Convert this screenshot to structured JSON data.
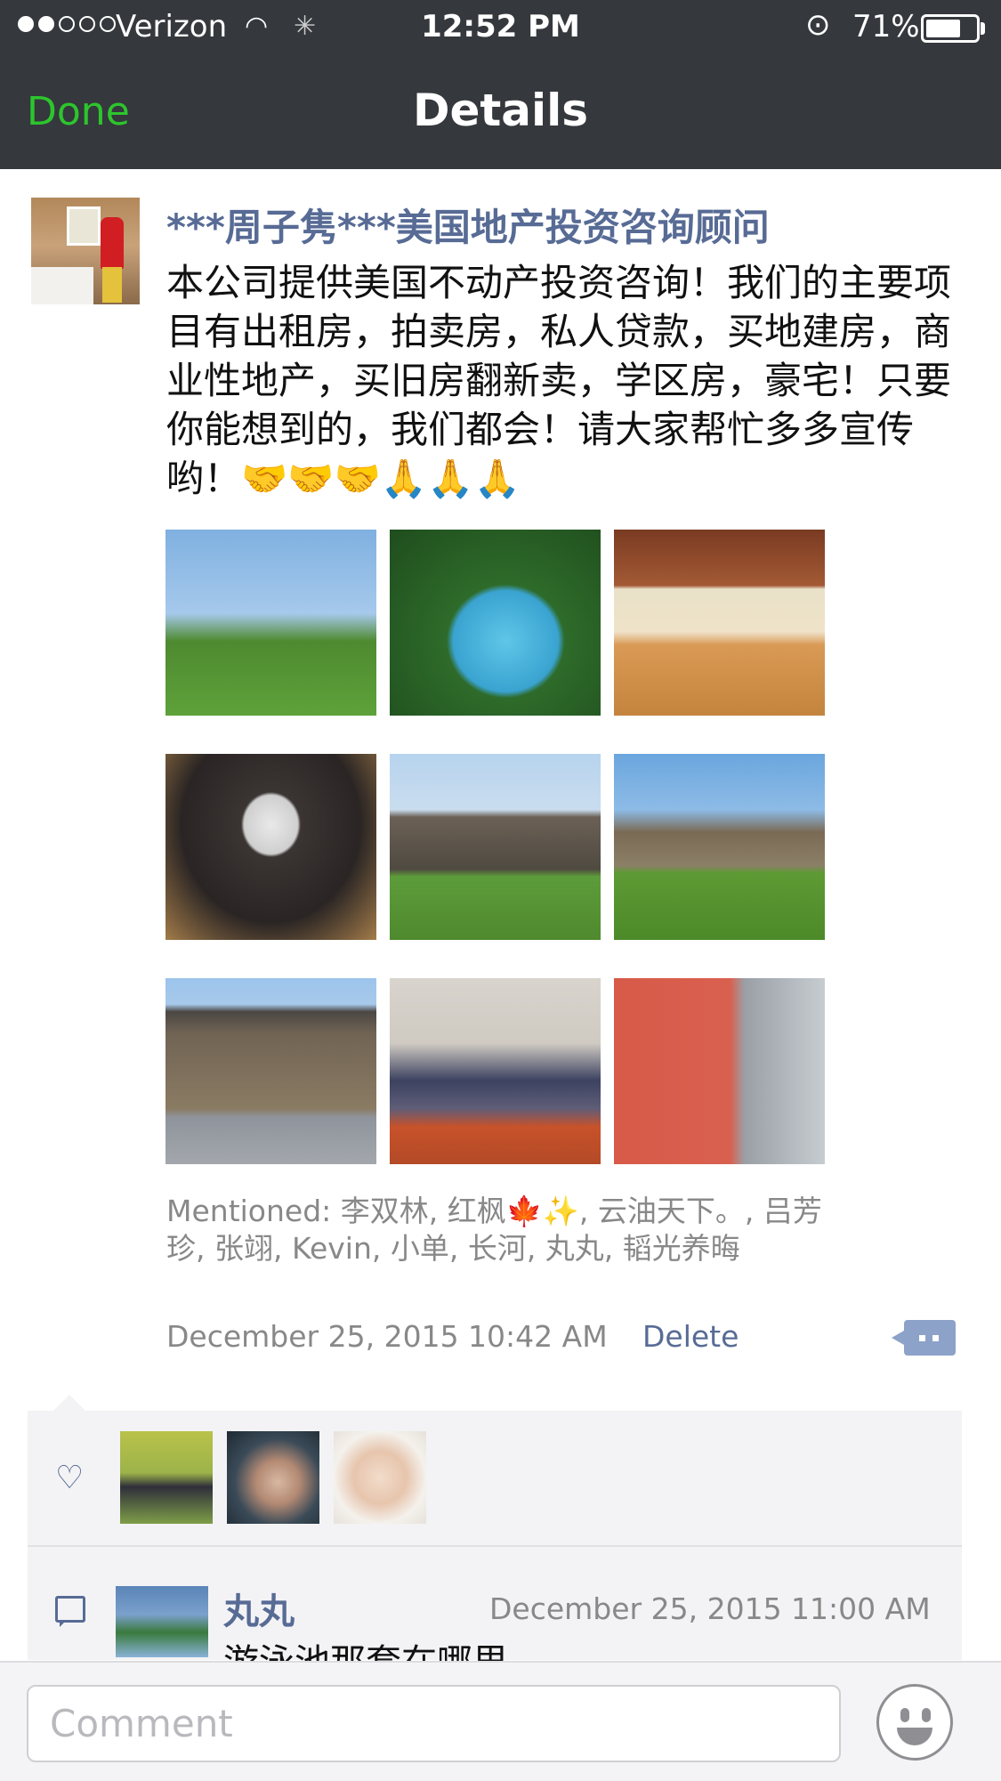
{
  "status_bar": {
    "carrier": "Verizon",
    "time": "12:52 PM",
    "battery_percent": "71%",
    "battery_level": 0.71,
    "signal_bars_filled": 2,
    "signal_bars_total": 5
  },
  "nav": {
    "done_label": "Done",
    "title": "Details"
  },
  "post": {
    "author": "***周子隽***美国地产投资咨询顾问",
    "text": "本公司提供美国不动产投资咨询！我们的主要项目有出租房，拍卖房，私人贷款，买地建房，商业性地产，买旧房翻新卖，学区房，豪宅！只要你能想到的，我们都会！请大家帮忙多多宣传哟！🤝🤝🤝🙏🙏🙏",
    "photos": [
      {
        "name": "house-lawn-photo"
      },
      {
        "name": "pool-photo"
      },
      {
        "name": "basketball-court-photo"
      },
      {
        "name": "home-theater-photo"
      },
      {
        "name": "greenhouse-photo"
      },
      {
        "name": "house-garden-photo"
      },
      {
        "name": "stone-garage-photo"
      },
      {
        "name": "gym-photo"
      },
      {
        "name": "kitchen-photo"
      }
    ],
    "mentioned": "Mentioned: 李双林, 红枫🍁✨, 云油天下。, 吕芳珍, 张翊, Kevin, 小单, 长河, 丸丸, 韬光养晦",
    "timestamp": "December 25, 2015 10:42 AM",
    "delete_label": "Delete"
  },
  "likes": {
    "avatars": [
      "like-avatar-1",
      "like-avatar-2",
      "like-avatar-3"
    ]
  },
  "comment": {
    "author": "丸丸",
    "timestamp": "December 25, 2015 11:00 AM",
    "text": "游泳池那套在哪里"
  },
  "composer": {
    "placeholder": "Comment"
  },
  "colors": {
    "accent_green": "#2dc52d",
    "link_blue": "#576b95",
    "nav_background": "#35383d"
  }
}
